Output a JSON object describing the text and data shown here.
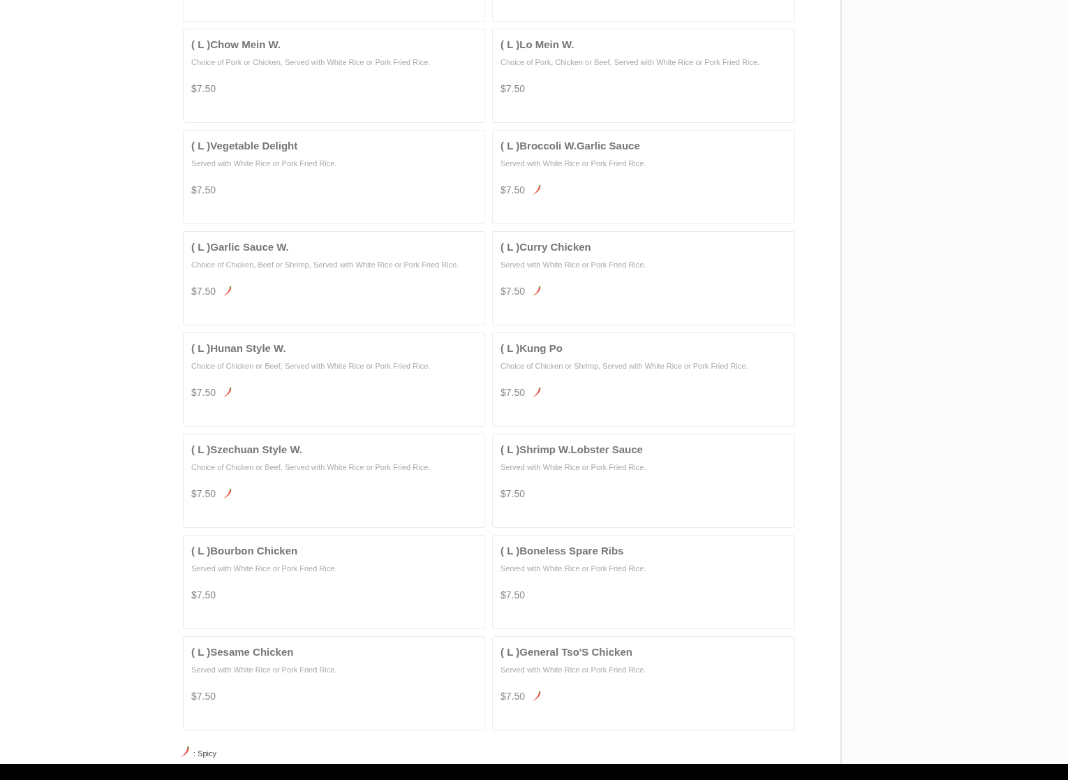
{
  "items": [
    {
      "name": "( L )Chow Mein W.",
      "description": "Choice of Pork or Chicken, Served with White Rice or Pork Fried Rice.",
      "price": "$7.50",
      "spicy": false
    },
    {
      "name": "( L )Lo Mein W.",
      "description": "Choice of Pork, Chicken or Beef, Served with White Rice or Pork Fried Rice.",
      "price": "$7.50",
      "spicy": false
    },
    {
      "name": "( L )Vegetable Delight",
      "description": "Served with White Rice or Pork Fried Rice.",
      "price": "$7.50",
      "spicy": false
    },
    {
      "name": "( L )Broccoli W.Garlic Sauce",
      "description": "Served with White Rice or Pork Fried Rice.",
      "price": "$7.50",
      "spicy": true
    },
    {
      "name": "( L )Garlic Sauce W.",
      "description": "Choice of Chicken, Beef or Shrimp, Served with White Rice or Pork Fried Rice.",
      "price": "$7.50",
      "spicy": true
    },
    {
      "name": "( L )Curry Chicken",
      "description": "Served with White Rice or Pork Fried Rice.",
      "price": "$7.50",
      "spicy": true
    },
    {
      "name": "( L )Hunan Style W.",
      "description": "Choice of Chicken or Beef, Served with White Rice or Pork Fried Rice.",
      "price": "$7.50",
      "spicy": true
    },
    {
      "name": "( L )Kung Po",
      "description": "Choice of Chicken or Shrimp, Served with White Rice or Pork Fried Rice.",
      "price": "$7.50",
      "spicy": true
    },
    {
      "name": "( L )Szechuan Style W.",
      "description": "Choice of Chicken or Beef, Served with White Rice or Pork Fried Rice.",
      "price": "$7.50",
      "spicy": true
    },
    {
      "name": "( L )Shrimp W.Lobster Sauce",
      "description": "Served with White Rice or Pork Fried Rice.",
      "price": "$7.50",
      "spicy": false
    },
    {
      "name": "( L )Bourbon Chicken",
      "description": "Served with White Rice or Pork Fried Rice.",
      "price": "$7.50",
      "spicy": false
    },
    {
      "name": "( L )Boneless Spare Ribs",
      "description": "Served with White Rice or Pork Fried Rice.",
      "price": "$7.50",
      "spicy": false
    },
    {
      "name": "( L )Sesame Chicken",
      "description": "Served with White Rice or Pork Fried Rice.",
      "price": "$7.50",
      "spicy": false
    },
    {
      "name": "( L )General Tso'S Chicken",
      "description": "Served with White Rice or Pork Fried Rice.",
      "price": "$7.50",
      "spicy": true
    }
  ],
  "legend": {
    "label": ": Spicy"
  }
}
